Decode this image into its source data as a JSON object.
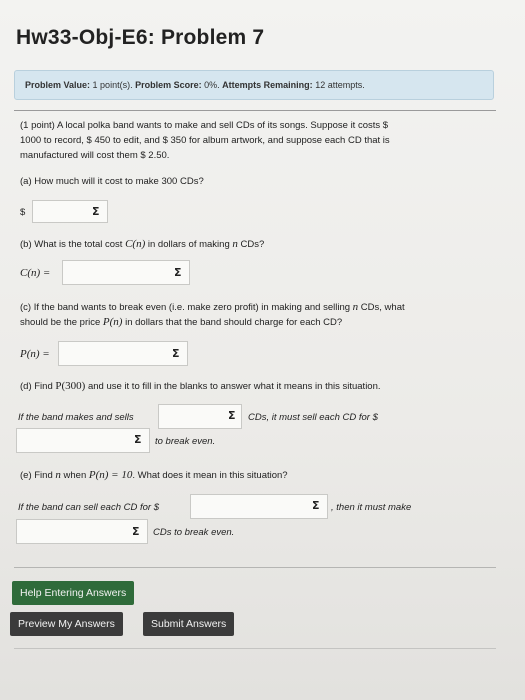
{
  "header": {
    "title": "Hw33-Obj-E6: Problem 7"
  },
  "info_bar": {
    "value_label": "Problem Value:",
    "value": "1 point(s).",
    "score_label": "Problem Score:",
    "score": "0%.",
    "attempts_label": "Attempts Remaining:",
    "attempts": "12 attempts."
  },
  "problem": {
    "line1": "(1 point) A local polka band wants to make and sell CDs of its songs. Suppose it costs $",
    "line2": "1000 to record, $ 450 to edit, and $ 350 for album artwork, and suppose each CD that is",
    "line3": "manufactured will cost them $ 2.50."
  },
  "part_a": {
    "question": "(a) How much will it cost to make 300 CDs?",
    "prefix": "$",
    "value": ""
  },
  "part_b": {
    "q_pre": "(b) What is the total cost ",
    "q_func": "C(n)",
    "q_mid": " in dollars of making ",
    "q_var": "n",
    "q_post": " CDs?",
    "label": "C(n) =",
    "value": ""
  },
  "part_c": {
    "q1_pre": "(c) If the band wants to break even (i.e. make zero profit) in making and selling ",
    "q1_var": "n",
    "q1_post": " CDs, what",
    "q2_pre": "should be the price ",
    "q2_func": "P(n)",
    "q2_post": " in dollars that the band should charge for each CD?",
    "label": "P(n) =",
    "value": ""
  },
  "part_d": {
    "q_pre": "(d) Find ",
    "q_func": "P(300)",
    "q_post": " and use it to fill in the blanks to answer what it means in this situation.",
    "s1": "If the band makes and sells",
    "s2": "CDs, it must sell each CD for $",
    "s3": "to break even.",
    "value1": "",
    "value2": ""
  },
  "part_e": {
    "q_pre": "(e) Find ",
    "q_var": "n",
    "q_mid": " when ",
    "q_eq": "P(n) = 10",
    "q_post": ". What does it mean in this situation?",
    "s1": "If the band can sell each CD for $",
    "s2": ", then it must make",
    "s3": "CDs to break even.",
    "value1": "",
    "value2": ""
  },
  "buttons": {
    "help": "Help Entering Answers",
    "preview": "Preview My Answers",
    "submit": "Submit Answers"
  },
  "icons": {
    "sigma": "Σ"
  },
  "colors": {
    "info_bg": "#d6e6ef",
    "help_button": "#2f6b3a",
    "dark_button": "#3b3b3b"
  }
}
